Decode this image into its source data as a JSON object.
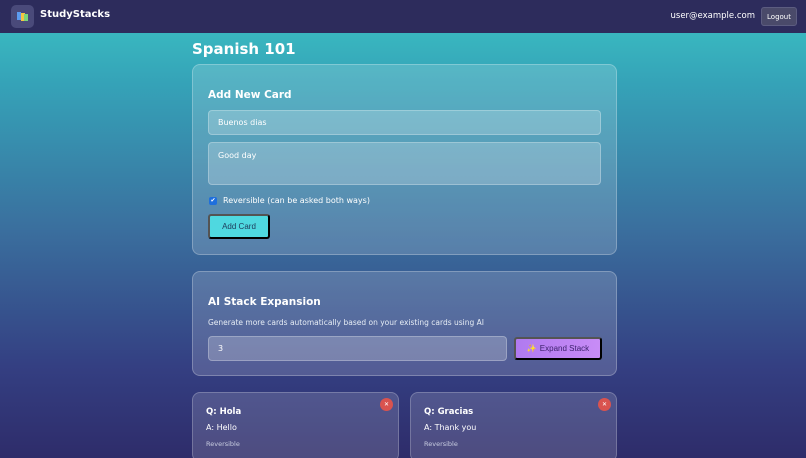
{
  "app": {
    "brand": "StudyStacks",
    "user_email": "user@example.com",
    "logout_label": "Logout"
  },
  "page": {
    "title": "Spanish 101"
  },
  "add_card": {
    "heading": "Add New Card",
    "question_value": "Buenos dias",
    "answer_value": "Good day",
    "reversible_checked": true,
    "reversible_label": "Reversible (can be asked both ways)",
    "submit_label": "Add Card"
  },
  "ai_expansion": {
    "heading": "AI Stack Expansion",
    "description": "Generate more cards automatically based on your existing cards using AI",
    "count_value": "3",
    "button_icon": "✨",
    "button_label": "Expand Stack"
  },
  "cards": [
    {
      "question": "Q: Hola",
      "answer": "A: Hello",
      "tag": "Reversible"
    },
    {
      "question": "Q: Gracias",
      "answer": "A: Thank you",
      "tag": "Reversible"
    }
  ],
  "icons": {
    "logo": "stack-logo-icon",
    "delete": "close-icon",
    "check": "check-icon"
  },
  "colors": {
    "topbar": "#2d2c5c",
    "accent_cyan": "#4fd8e0",
    "accent_purple": "#b07af0",
    "delete_red": "#d9534f",
    "checkbox_blue": "#1f6fdc"
  }
}
